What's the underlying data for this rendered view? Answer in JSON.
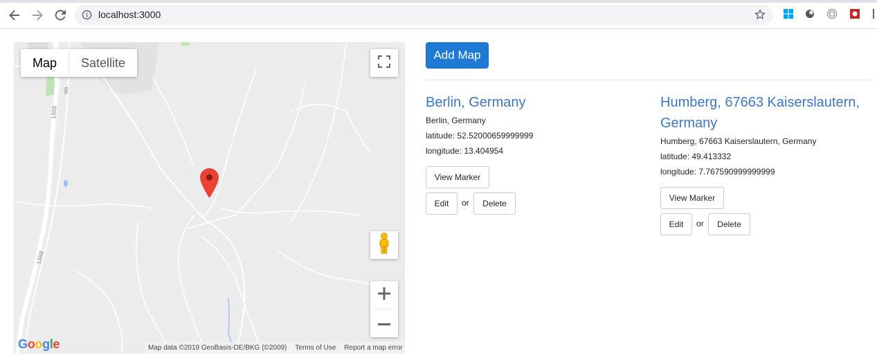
{
  "browser": {
    "url": "localhost:3000",
    "icons": [
      "back-icon",
      "forward-icon",
      "reload-icon",
      "info-icon",
      "star-icon"
    ]
  },
  "map": {
    "type_buttons": {
      "map": "Map",
      "satellite": "Satellite"
    },
    "road_labels": [
      "L503",
      "L503",
      "Str."
    ],
    "logo": "Google",
    "attribution": {
      "data": "Map data ©2019 GeoBasis-DE/BKG (©2009)",
      "terms": "Terms of Use",
      "report": "Report a map error"
    },
    "colors": {
      "marker": "#ea4335",
      "background": "#ececec"
    }
  },
  "actions": {
    "add_map": "Add Map"
  },
  "locations": [
    {
      "title": "Berlin, Germany",
      "address": "Berlin, Germany",
      "latitude": "latitude: 52.52000659999999",
      "longitude": "longitude: 13.404954",
      "view_marker": "View Marker",
      "edit": "Edit",
      "or": "or",
      "delete": "Delete"
    },
    {
      "title_line1": "Humberg, 67663 Kaiserslautern,",
      "title_line2": "Germany",
      "address": "Humberg, 67663 Kaiserslautern, Germany",
      "latitude": "latitude: 49.413332",
      "longitude": "longitude: 7.767590999999999",
      "view_marker": "View Marker",
      "edit": "Edit",
      "or": "or",
      "delete": "Delete"
    }
  ],
  "colors": {
    "accent": "#1f7ad6",
    "link": "#3b78c0"
  }
}
